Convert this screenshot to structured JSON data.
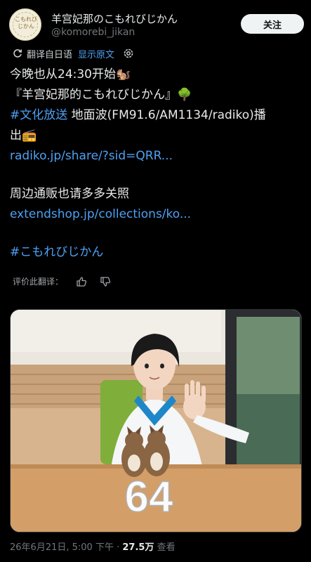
{
  "author": {
    "avatar_text": "こもれびじかん",
    "name": "羊宫妃那のこもれびじかん",
    "handle": "@komorebi_jikan",
    "follow_label": "关注"
  },
  "translation": {
    "label": "翻译自日语",
    "show_original": "显示原文"
  },
  "post": {
    "line1": "今晚也从24:30开始🐿️",
    "line2": "『羊宫妃那的こもれびじかん』🌳",
    "line3_hashtag": "#文化放送",
    "line3_rest": " 地面波(FM91.6/AM1134/radiko)播",
    "line4": "出📻",
    "link1": "radiko.jp/share/?sid=QRR...",
    "line5": "周边通贩也请多多关照",
    "link2": "extendshop.jp/collections/ko...",
    "hashtag2": "#こもれびじかん"
  },
  "rating": {
    "label": "评价此翻译："
  },
  "photo": {
    "sign_number": "64"
  },
  "meta": {
    "date": "26年6月21日, 5:00 下午",
    "sep": " · ",
    "views": "27.5万",
    "views_label": " 查看"
  }
}
